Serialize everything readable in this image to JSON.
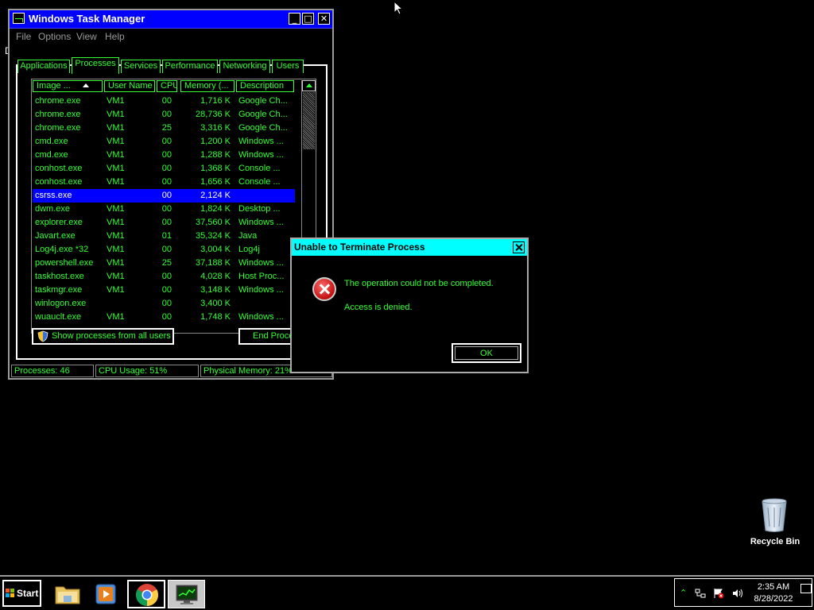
{
  "taskmgr": {
    "title": "Windows Task Manager",
    "controls": {
      "minimize": "_",
      "maximize": "□",
      "close": "✕"
    },
    "menu": [
      "File",
      "Options",
      "View",
      "Help"
    ],
    "tabs": [
      "Applications",
      "Processes",
      "Services",
      "Performance",
      "Networking",
      "Users"
    ],
    "active_tab": "Processes",
    "columns": [
      "Image ...",
      "User Name",
      "CPU",
      "Memory (...",
      "Description"
    ],
    "rows": [
      {
        "image": "chrome.exe",
        "user": "VM1",
        "cpu": "00",
        "mem": "1,716 K",
        "desc": "Google Ch..."
      },
      {
        "image": "chrome.exe",
        "user": "VM1",
        "cpu": "00",
        "mem": "28,736 K",
        "desc": "Google Ch..."
      },
      {
        "image": "chrome.exe",
        "user": "VM1",
        "cpu": "25",
        "mem": "3,316 K",
        "desc": "Google Ch..."
      },
      {
        "image": "cmd.exe",
        "user": "VM1",
        "cpu": "00",
        "mem": "1,200 K",
        "desc": "Windows ..."
      },
      {
        "image": "cmd.exe",
        "user": "VM1",
        "cpu": "00",
        "mem": "1,288 K",
        "desc": "Windows ..."
      },
      {
        "image": "conhost.exe",
        "user": "VM1",
        "cpu": "00",
        "mem": "1,368 K",
        "desc": "Console ..."
      },
      {
        "image": "conhost.exe",
        "user": "VM1",
        "cpu": "00",
        "mem": "1,656 K",
        "desc": "Console ..."
      },
      {
        "image": "csrss.exe",
        "user": "",
        "cpu": "00",
        "mem": "2,124 K",
        "desc": "",
        "selected": true
      },
      {
        "image": "dwm.exe",
        "user": "VM1",
        "cpu": "00",
        "mem": "1,824 K",
        "desc": "Desktop ..."
      },
      {
        "image": "explorer.exe",
        "user": "VM1",
        "cpu": "00",
        "mem": "37,560 K",
        "desc": "Windows ..."
      },
      {
        "image": "Javart.exe",
        "user": "VM1",
        "cpu": "01",
        "mem": "35,324 K",
        "desc": "Java"
      },
      {
        "image": "Log4j.exe *32",
        "user": "VM1",
        "cpu": "00",
        "mem": "3,004 K",
        "desc": "Log4j"
      },
      {
        "image": "powershell.exe",
        "user": "VM1",
        "cpu": "25",
        "mem": "37,188 K",
        "desc": "Windows ..."
      },
      {
        "image": "taskhost.exe",
        "user": "VM1",
        "cpu": "00",
        "mem": "4,028 K",
        "desc": "Host Proc..."
      },
      {
        "image": "taskmgr.exe",
        "user": "VM1",
        "cpu": "00",
        "mem": "3,148 K",
        "desc": "Windows ..."
      },
      {
        "image": "winlogon.exe",
        "user": "",
        "cpu": "00",
        "mem": "3,400 K",
        "desc": ""
      },
      {
        "image": "wuauclt.exe",
        "user": "VM1",
        "cpu": "00",
        "mem": "1,748 K",
        "desc": "Windows ..."
      }
    ],
    "show_all_label": "Show processes from all users",
    "end_process_label": "End Proce",
    "status": {
      "processes": "Processes: 46",
      "cpu": "CPU Usage: 51%",
      "memory": "Physical Memory: 21%"
    }
  },
  "dialog": {
    "title": "Unable to Terminate Process",
    "message": "The operation could not be completed.",
    "detail": "Access is denied.",
    "ok_label": "OK",
    "icon": "error-icon"
  },
  "desktop": {
    "recycle_bin_label": "Recycle Bin",
    "stray_char": "D"
  },
  "taskbar": {
    "start_label": "Start",
    "clock_time": "2:35 AM",
    "clock_date": "8/28/2022",
    "pinned": [
      "file-explorer-icon",
      "media-player-icon",
      "chrome-icon",
      "task-manager-icon"
    ]
  },
  "colors": {
    "text_green": "#33ff33",
    "title_blue": "#0000ff",
    "dialog_title": "#00ffff",
    "selection": "#0000ff"
  }
}
